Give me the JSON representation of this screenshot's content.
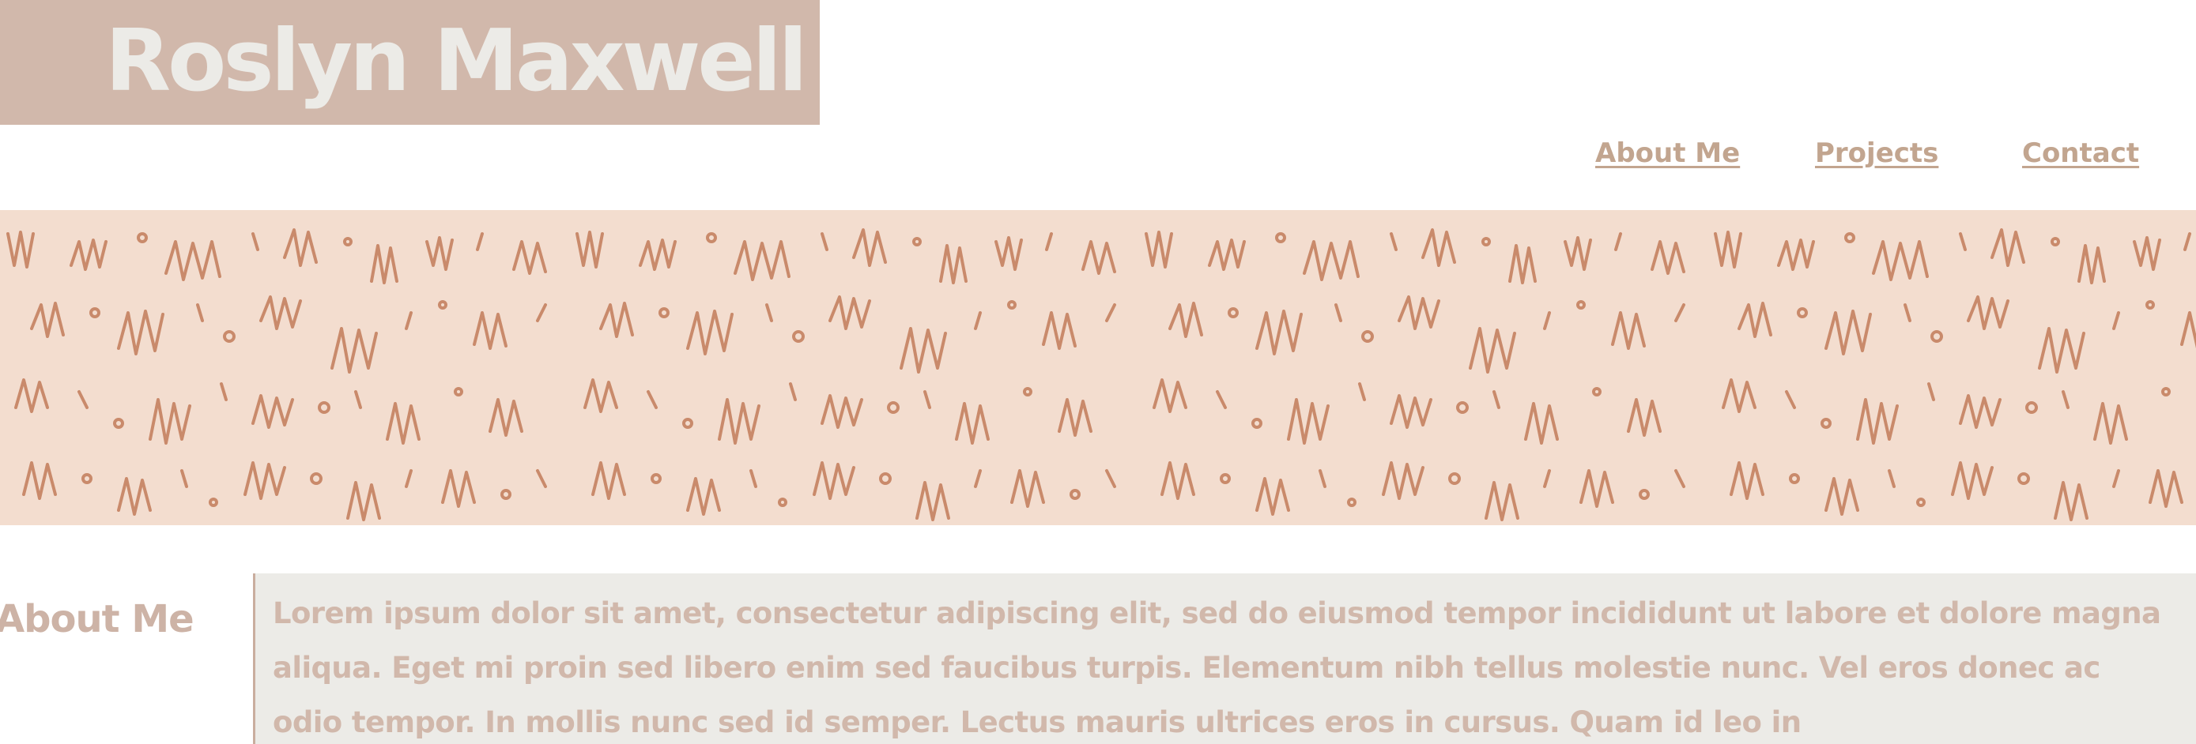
{
  "header": {
    "site_title": "Roslyn Maxwell"
  },
  "nav": {
    "items": [
      {
        "label": "About Me"
      },
      {
        "label": "Projects"
      },
      {
        "label": "Contact"
      }
    ]
  },
  "banner": {
    "pattern": "scribble-pattern",
    "background_color": "#f3ddcf",
    "stroke_color": "#c98a6b"
  },
  "about": {
    "heading": "About Me",
    "body": "Lorem ipsum dolor sit amet, consectetur adipiscing elit, sed do eiusmod tempor incididunt ut labore et dolore magna aliqua. Eget mi proin sed libero enim sed faucibus turpis. Elementum nibh tellus molestie nunc. Vel eros donec ac odio tempor. In mollis nunc sed id semper. Lectus mauris ultrices eros in cursus. Quam id leo in"
  },
  "colors": {
    "accent": "#d1b8ab",
    "nav_link": "#c2a58f",
    "panel": "#ecebe7"
  }
}
